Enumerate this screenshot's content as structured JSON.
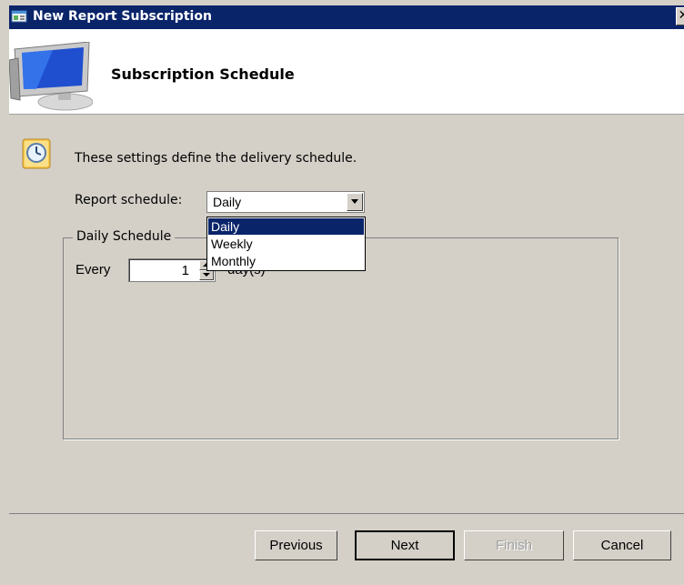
{
  "window": {
    "title": "New Report Subscription",
    "close_glyph": "✕",
    "app_icon": "report-subscription-icon"
  },
  "header": {
    "title": "Subscription Schedule",
    "icon": "monitor-icon"
  },
  "content": {
    "description": "These settings define the delivery schedule.",
    "icon": "clock-icon",
    "schedule": {
      "label": "Report schedule:",
      "selected": "Daily",
      "options": [
        "Daily",
        "Weekly",
        "Monthly"
      ]
    },
    "group": {
      "legend": "Daily Schedule",
      "every_label": "Every",
      "every_value": "1",
      "unit_label": "day(s)"
    }
  },
  "buttons": {
    "previous": "Previous",
    "next": "Next",
    "finish": "Finish",
    "cancel": "Cancel"
  },
  "colors": {
    "titlebar": "#0a246a",
    "selection": "#0a246a",
    "dialog_face": "#d4d0c8"
  }
}
